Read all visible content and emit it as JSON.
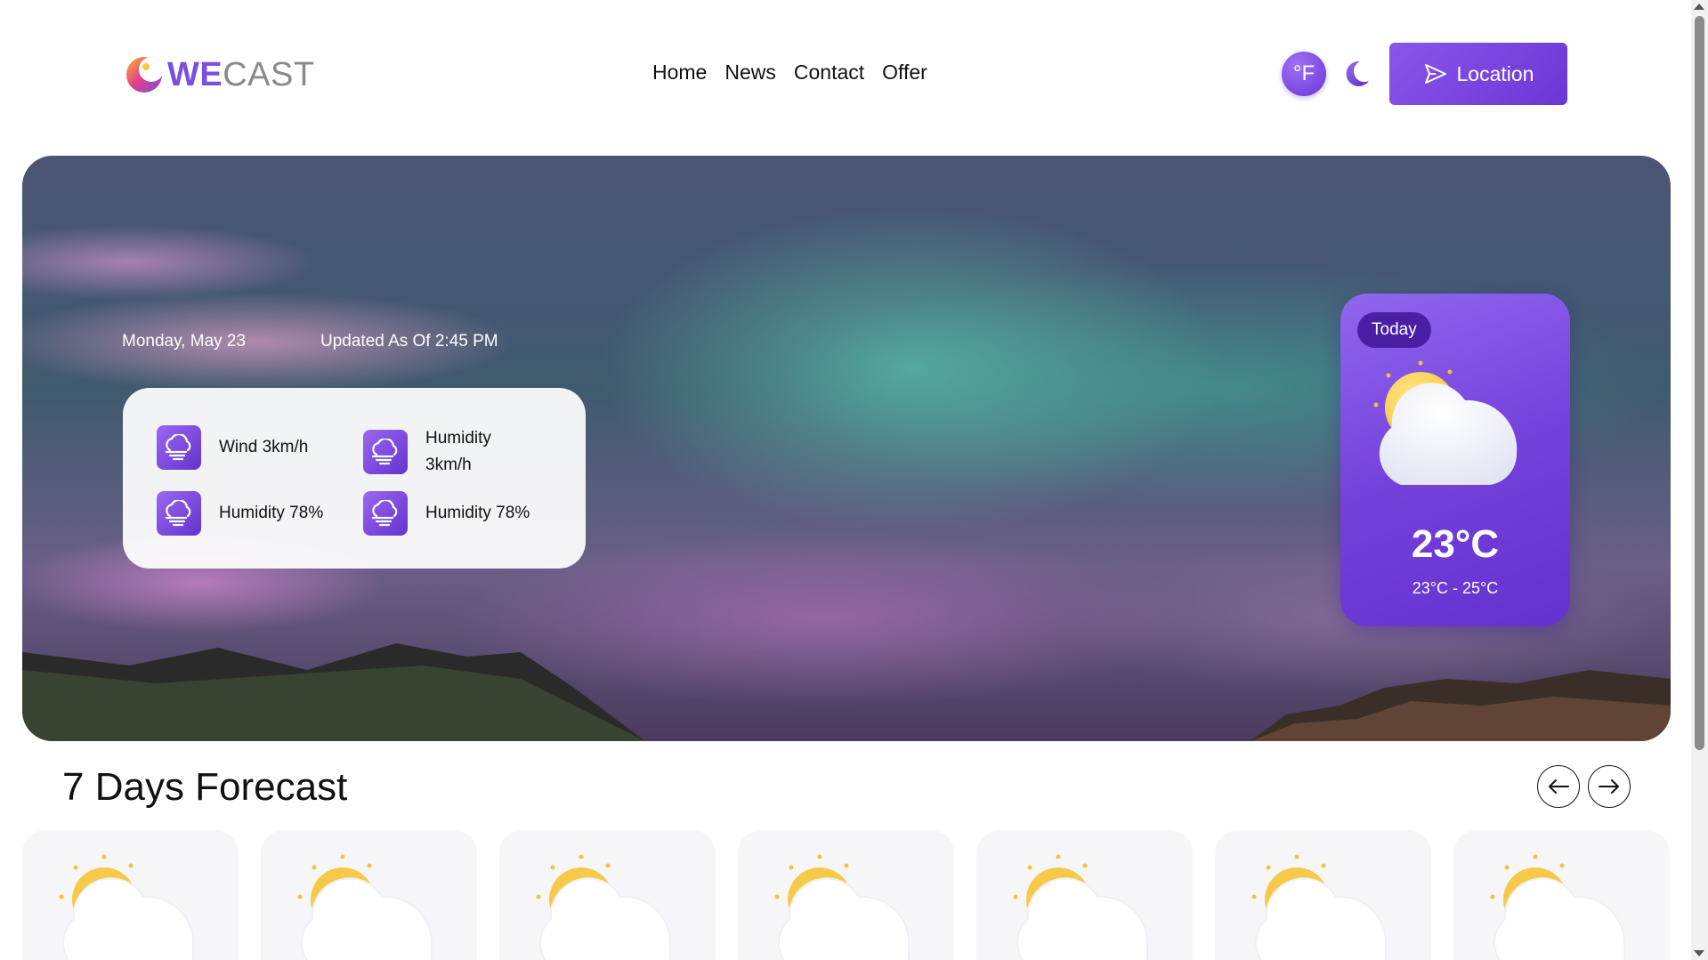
{
  "header": {
    "logo": {
      "we": "WE",
      "cast": "CAST",
      "icon": "moon-logo-icon"
    },
    "nav": [
      "Home",
      "News",
      "Contact",
      "Offer"
    ],
    "unit_button": "°F",
    "theme_icon": "moon-icon",
    "location_button": {
      "label": "Location",
      "icon": "send-icon"
    }
  },
  "hero": {
    "date": "Monday, May 23",
    "updated": "Updated As Of 2:45 PM",
    "stats": [
      {
        "label": "Wind 3km/h",
        "icon": "wind-cloud-icon"
      },
      {
        "label": "Humidity 3km/h",
        "icon": "wind-cloud-icon"
      },
      {
        "label": "Humidity 78%",
        "icon": "wind-cloud-icon"
      },
      {
        "label": "Humidity 78%",
        "icon": "wind-cloud-icon"
      }
    ],
    "today": {
      "badge": "Today",
      "temp": "23°C",
      "range": "23°C - 25°C",
      "icon": "partly-cloudy-icon"
    }
  },
  "forecast": {
    "title": "7 Days Forecast",
    "prev_icon": "arrow-left-icon",
    "next_icon": "arrow-right-icon",
    "days": [
      {
        "icon": "partly-cloudy-icon"
      },
      {
        "icon": "partly-cloudy-icon"
      },
      {
        "icon": "partly-cloudy-icon"
      },
      {
        "icon": "partly-cloudy-icon"
      },
      {
        "icon": "partly-cloudy-icon"
      },
      {
        "icon": "partly-cloudy-icon"
      },
      {
        "icon": "partly-cloudy-icon"
      }
    ]
  },
  "colors": {
    "accent": "#7b4fe0",
    "accent_dark": "#6331cf",
    "today_pill": "#4a1fa6"
  }
}
